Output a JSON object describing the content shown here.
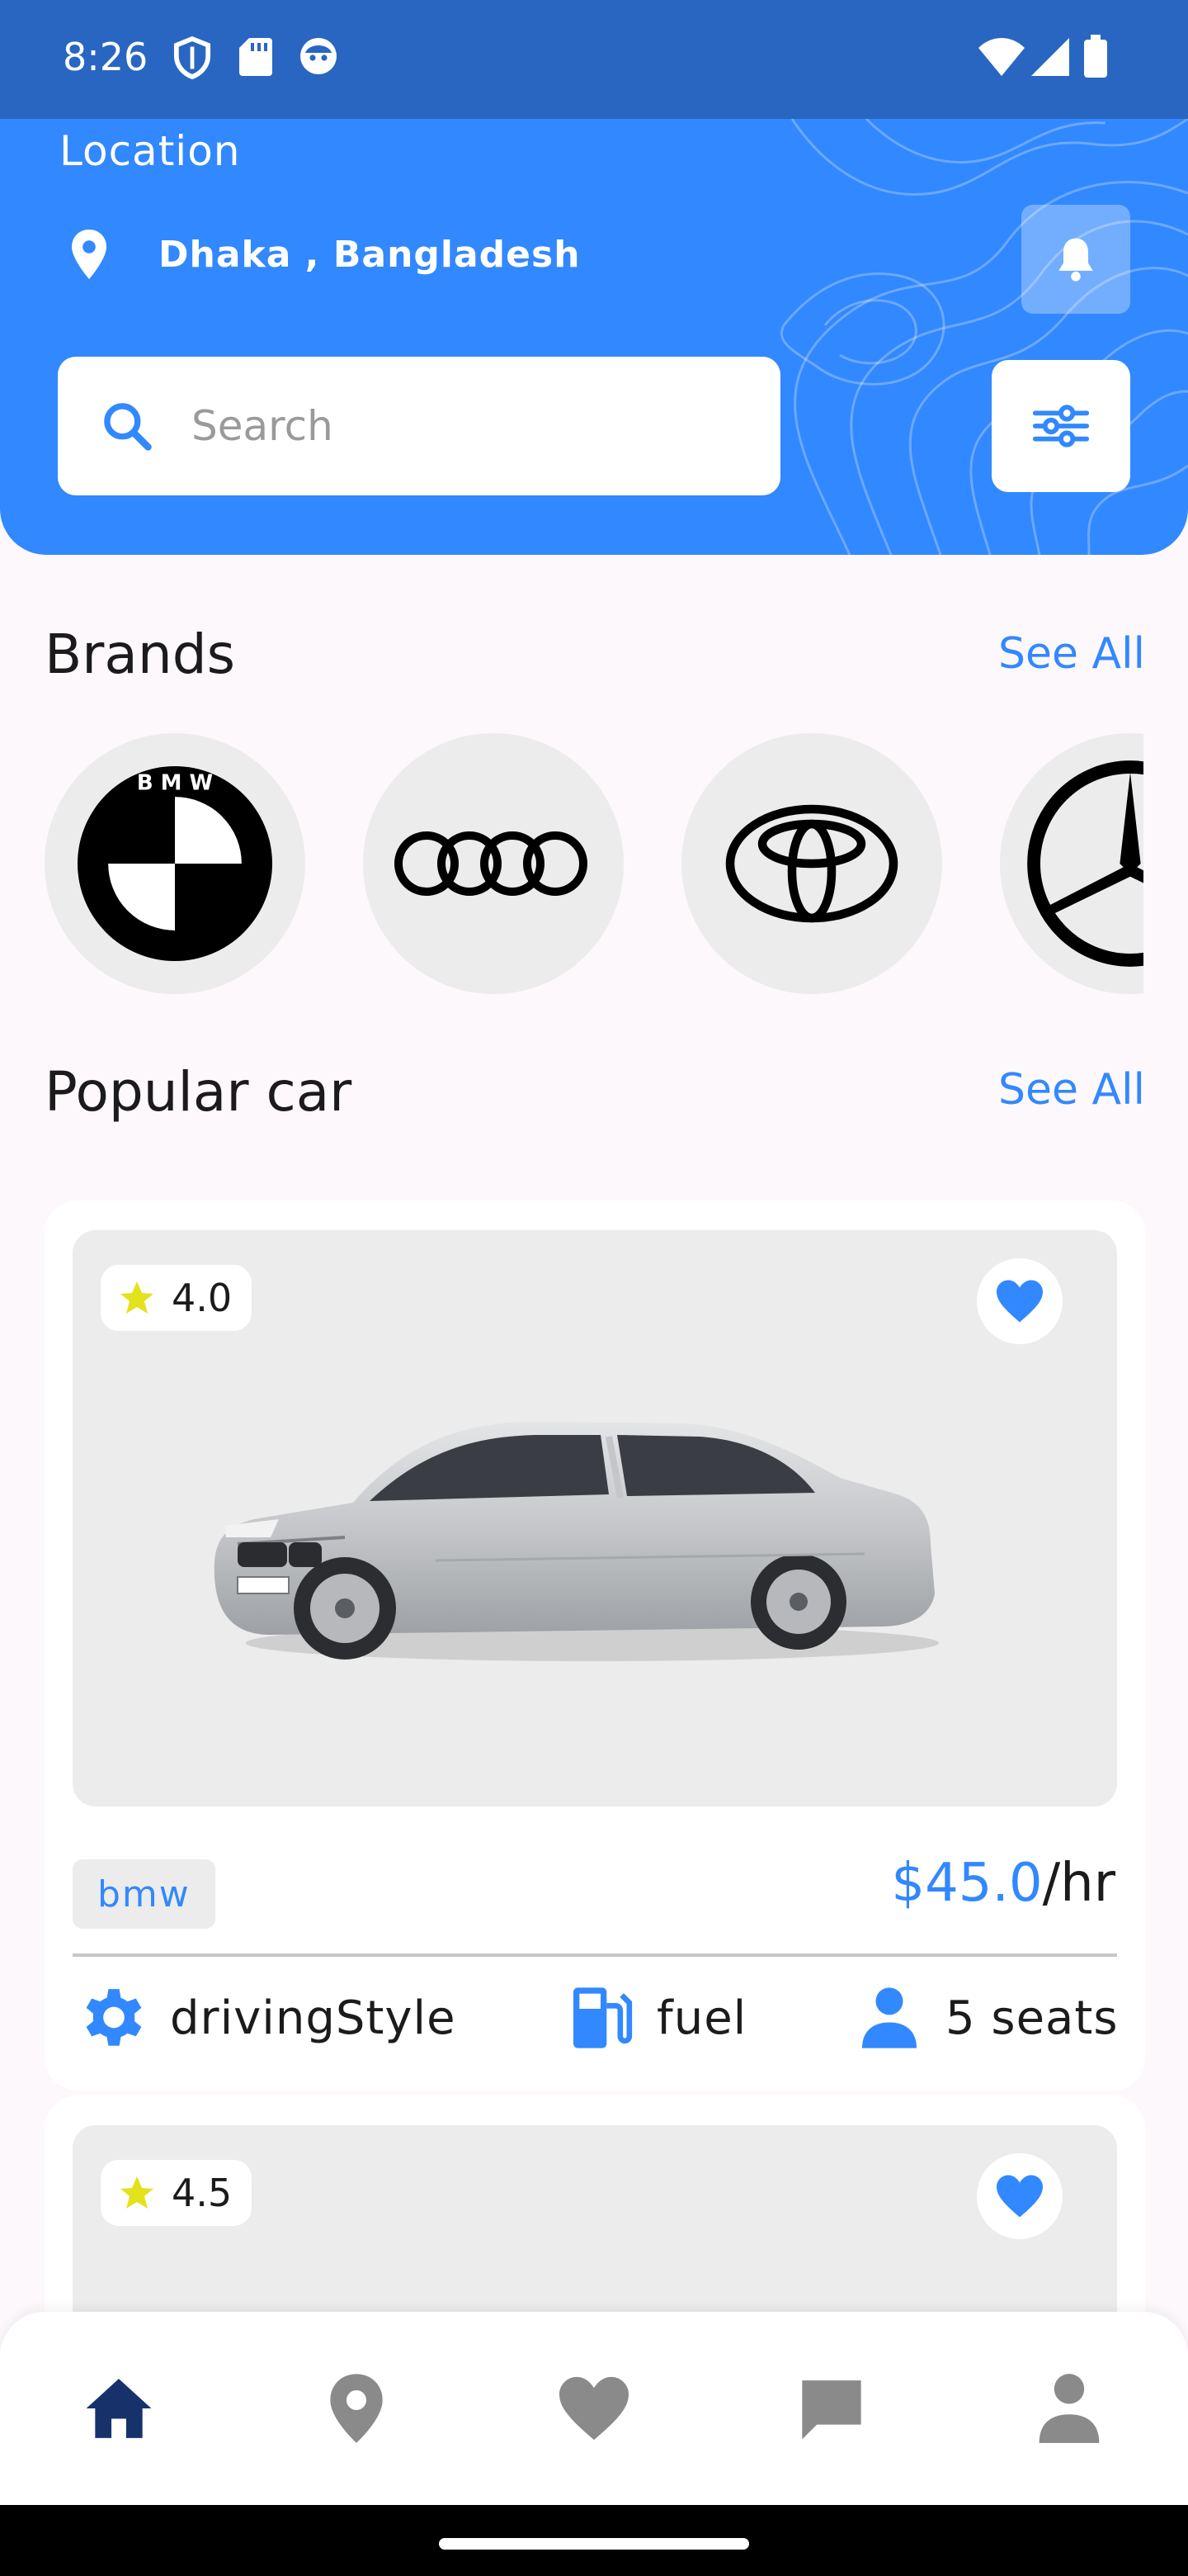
{
  "status_bar": {
    "time": "8:26",
    "icons_left": [
      "shield-icon",
      "sd-card-icon",
      "face-icon"
    ],
    "icons_right": [
      "wifi-icon",
      "signal-icon",
      "battery-icon"
    ]
  },
  "header": {
    "location_label": "Location",
    "location_value": "Dhaka , Bangladesh",
    "search_placeholder": "Search",
    "colors": {
      "header_bg": "#3288fe",
      "status_bg": "#2966c2"
    }
  },
  "brands_section": {
    "title": "Brands",
    "see_all": "See All",
    "items": [
      {
        "name": "bmw",
        "icon": "bmw-logo",
        "logo_text": "B M W"
      },
      {
        "name": "audi",
        "icon": "audi-logo"
      },
      {
        "name": "toyota",
        "icon": "toyota-logo"
      },
      {
        "name": "mercedes",
        "icon": "mercedes-logo"
      }
    ]
  },
  "popular_section": {
    "title": "Popular car",
    "see_all": "See All",
    "cars": [
      {
        "rating": "4.0",
        "brand": "bmw",
        "price": "$45.0",
        "price_unit": "/hr",
        "favorite": true,
        "specs": [
          {
            "icon": "gear-icon",
            "label": "drivingStyle"
          },
          {
            "icon": "fuel-pump-icon",
            "label": "fuel"
          },
          {
            "icon": "person-icon",
            "label": "5 seats"
          }
        ]
      },
      {
        "rating": "4.5",
        "favorite": true
      }
    ]
  },
  "bottom_nav": {
    "items": [
      {
        "name": "home",
        "icon": "home-icon",
        "active": true
      },
      {
        "name": "map",
        "icon": "location-pin-icon",
        "active": false
      },
      {
        "name": "favorites",
        "icon": "heart-icon",
        "active": false
      },
      {
        "name": "messages",
        "icon": "chat-icon",
        "active": false
      },
      {
        "name": "profile",
        "icon": "person-icon",
        "active": false
      }
    ],
    "colors": {
      "active": "#17326b",
      "inactive": "#8a8a8a"
    }
  }
}
